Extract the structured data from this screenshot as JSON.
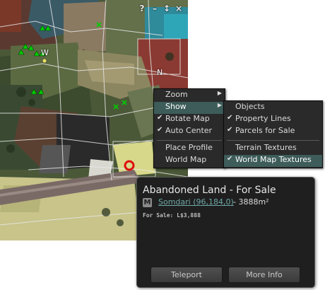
{
  "minimap": {
    "controls": {
      "help": "?",
      "minimize": "–",
      "resize": "↕",
      "close": "×"
    },
    "compass": {
      "west": "W",
      "north": "N"
    }
  },
  "context_menu": {
    "items": [
      {
        "label": "Zoom",
        "checked": false,
        "submenu": true
      },
      {
        "label": "Show",
        "checked": false,
        "submenu": true,
        "highlighted": true
      },
      {
        "label": "Rotate Map",
        "checked": true,
        "submenu": false
      },
      {
        "label": "Auto Center",
        "checked": true,
        "submenu": false
      },
      {
        "label": "Place Profile",
        "checked": false,
        "submenu": false
      },
      {
        "label": "World Map",
        "checked": false,
        "submenu": false
      }
    ],
    "check_glyph": "✔",
    "arrow_glyph": "▶"
  },
  "show_submenu": {
    "items": [
      {
        "label": "Objects",
        "checked": false
      },
      {
        "label": "Property Lines",
        "checked": true
      },
      {
        "label": "Parcels for Sale",
        "checked": true
      },
      {
        "label": "Terrain Textures",
        "checked": false
      },
      {
        "label": "World Map Textures",
        "checked": true,
        "highlighted": true
      }
    ]
  },
  "info_panel": {
    "title": "Abandoned Land - For Sale",
    "rating_badge": "M",
    "region_link": "Somdari (96,184,0)",
    "area": "- 3888m²",
    "sale_price": "For Sale: L$3,888",
    "teleport_label": "Teleport",
    "more_info_label": "More Info"
  },
  "colors": {
    "menu_bg": "#2a2a2a",
    "menu_highlight": "#3d5c5a",
    "link": "#6ea7a5",
    "avatar_marker": "#00cc00",
    "location_marker": "#dd1111",
    "for_sale_parcel": "#d8d88a"
  }
}
